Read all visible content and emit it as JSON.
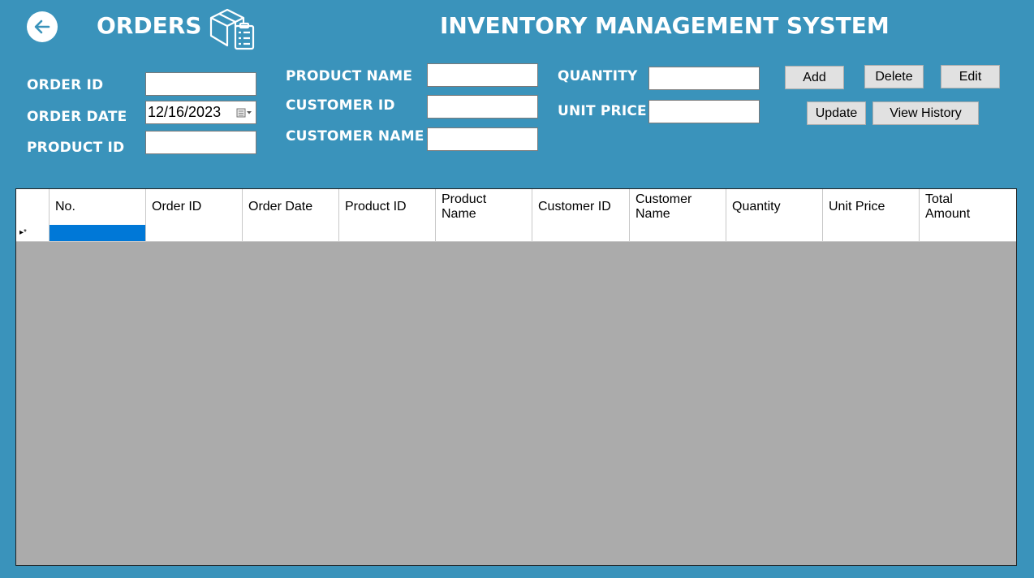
{
  "header": {
    "page_title": "ORDERS",
    "app_title": "INVENTORY MANAGEMENT SYSTEM"
  },
  "form": {
    "order_id_label": "ORDER ID",
    "order_date_label": "ORDER DATE",
    "product_id_label": "PRODUCT ID",
    "product_name_label": "PRODUCT NAME",
    "customer_id_label": "CUSTOMER ID",
    "customer_name_label": "CUSTOMER NAME",
    "quantity_label": "QUANTITY",
    "unit_price_label": "UNIT PRICE",
    "order_id": "",
    "order_date": "12/16/2023",
    "product_id": "",
    "product_name": "",
    "customer_id": "",
    "customer_name": "",
    "quantity": "",
    "unit_price": ""
  },
  "buttons": {
    "add": "Add",
    "delete": "Delete",
    "edit": "Edit",
    "update": "Update",
    "view_history": "View History"
  },
  "table": {
    "columns": [
      "No.",
      "Order ID",
      "Order Date",
      "Product ID",
      "Product Name",
      "Customer ID",
      "Customer Name",
      "Quantity",
      "Unit Price",
      "Total Amount"
    ],
    "new_row_marker": "▸*",
    "rows": []
  },
  "colors": {
    "background": "#3a93bb",
    "selection": "#0078d7",
    "grid_empty": "#ababab"
  }
}
